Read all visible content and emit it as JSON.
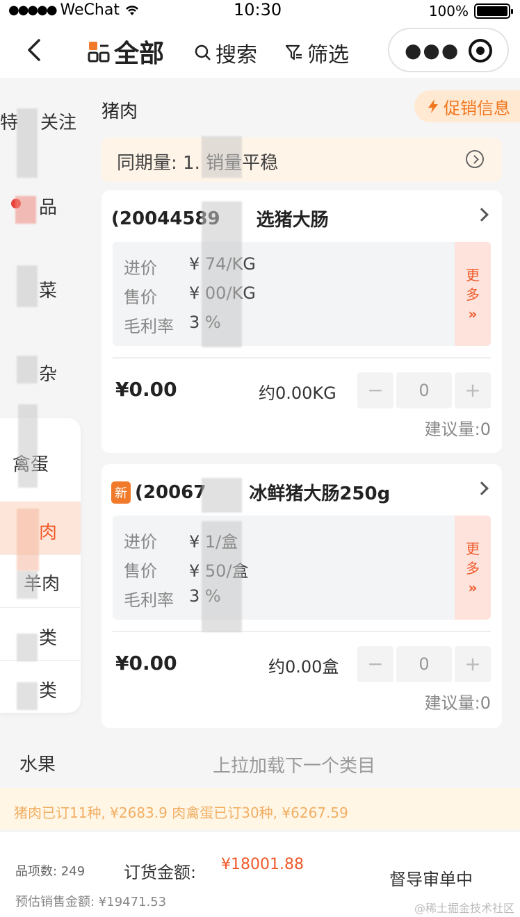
{
  "status_bar": {
    "carrier": "WeChat",
    "time": "10:30",
    "battery": "100%"
  },
  "nav": {
    "all_label": "全部",
    "search_label": "搜索",
    "filter_label": "筛选"
  },
  "sidebar": {
    "items": [
      {
        "label": "关注"
      },
      {
        "label": "品"
      },
      {
        "label": "菜"
      },
      {
        "label": "杂"
      },
      {
        "label": "禽蛋"
      },
      {
        "label": "肉"
      },
      {
        "label": "羊肉"
      },
      {
        "label": "类"
      },
      {
        "label": "类"
      }
    ],
    "partial_first": "特",
    "partial_meat": "肉"
  },
  "main": {
    "section_title": "猪肉",
    "promo_label": "促销信息",
    "yoy_text": "同期量: 1.    销量平稳",
    "cards": [
      {
        "is_new": false,
        "name_prefix": "(20044589",
        "name_suffix": "选猪大肠",
        "purchase_label": "进价",
        "purchase_value": "¥      74/KG",
        "sale_label": "售价",
        "sale_value": "¥      00/KG",
        "margin_label": "毛利率",
        "margin_value": "3        %",
        "more_label": "更多",
        "more_arrow": "»",
        "total": "¥0.00",
        "approx": "约0.00KG",
        "qty": "0",
        "suggest": "建议量:0"
      },
      {
        "is_new": true,
        "new_badge": "新",
        "name_prefix": "(20067",
        "name_suffix": "冰鲜猪大肠250g",
        "purchase_label": "进价",
        "purchase_value": "¥       1/盒",
        "sale_label": "售价",
        "sale_value": "¥       50/盒",
        "margin_label": "毛利率",
        "margin_value": "3        %",
        "more_label": "更多",
        "more_arrow": "»",
        "total": "¥0.00",
        "approx": "约0.00盒",
        "qty": "0",
        "suggest": "建议量:0"
      }
    ],
    "next_category": "水果",
    "load_more": "上拉加载下一个类目"
  },
  "summary_strip": "猪肉已订11种, ¥2683.9  肉禽蛋已订30种, ¥6267.59",
  "footer": {
    "count_label": "品项数: 249",
    "order_label": "订货金额:",
    "order_amount": "¥18001.88",
    "est_label": "预估销售金额: ¥19471.53",
    "submit_label": "督导审单中",
    "watermark": "@稀土掘金技术社区"
  }
}
